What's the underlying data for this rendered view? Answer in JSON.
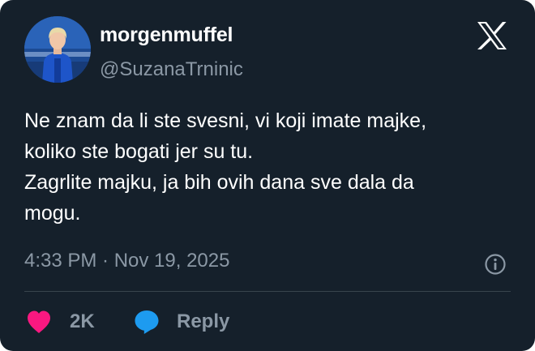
{
  "author": {
    "display_name": "morgenmuffel",
    "handle": "@SuzanaTrninic",
    "avatar_icon": "profile-photo"
  },
  "platform_icon": "x-logo-icon",
  "tweet": {
    "text": "Ne znam da li ste svesni, vi koji imate majke,\nkoliko ste bogati jer su tu.\nZagrlite majku, ja bih ovih dana sve dala da\nmogu.",
    "timestamp": "4:33 PM · Nov 19, 2025"
  },
  "actions": {
    "like_count": "2K",
    "reply_label": "Reply"
  },
  "colors": {
    "background": "#15202b",
    "text_primary": "#ffffff",
    "text_secondary": "#8b98a5",
    "divider": "#38444d",
    "like": "#f91880",
    "reply": "#1d9bf0"
  }
}
